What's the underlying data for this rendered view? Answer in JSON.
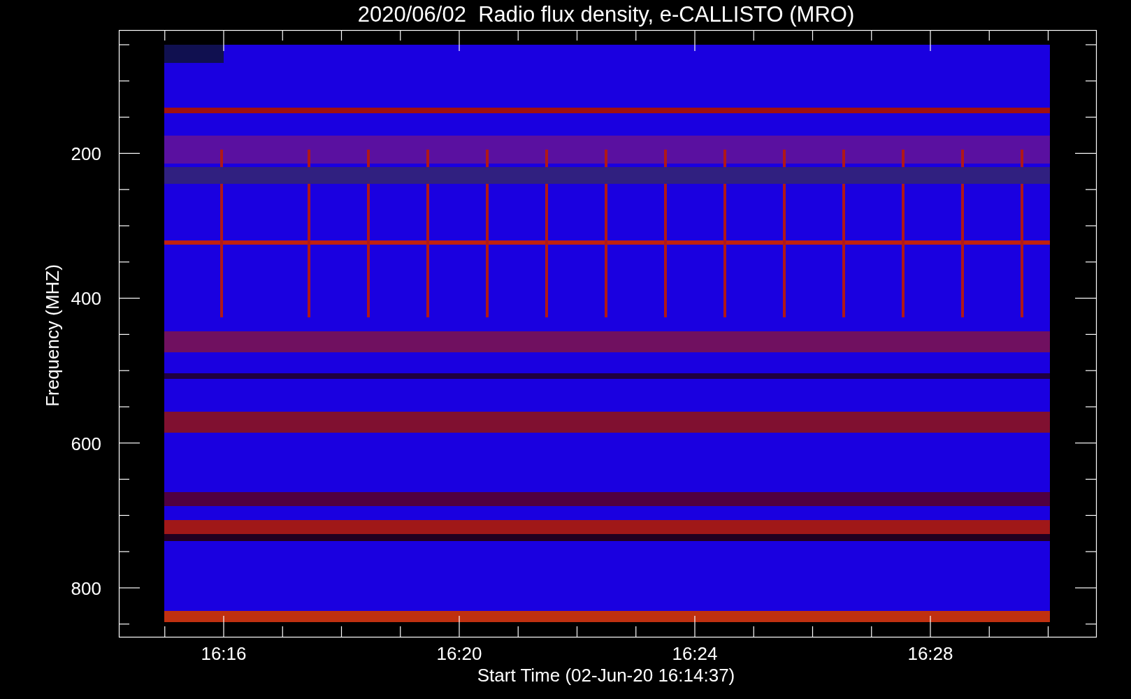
{
  "title": "2020/06/02  Radio flux density, e-CALLISTO (MRO)",
  "y_axis": {
    "label": "Frequency (MHZ)",
    "ticks": [
      "200",
      "400",
      "600",
      "800"
    ]
  },
  "x_axis": {
    "label": "Start Time (02-Jun-20 16:14:37)",
    "ticks": [
      "16:16",
      "16:20",
      "16:24",
      "16:28"
    ]
  }
}
